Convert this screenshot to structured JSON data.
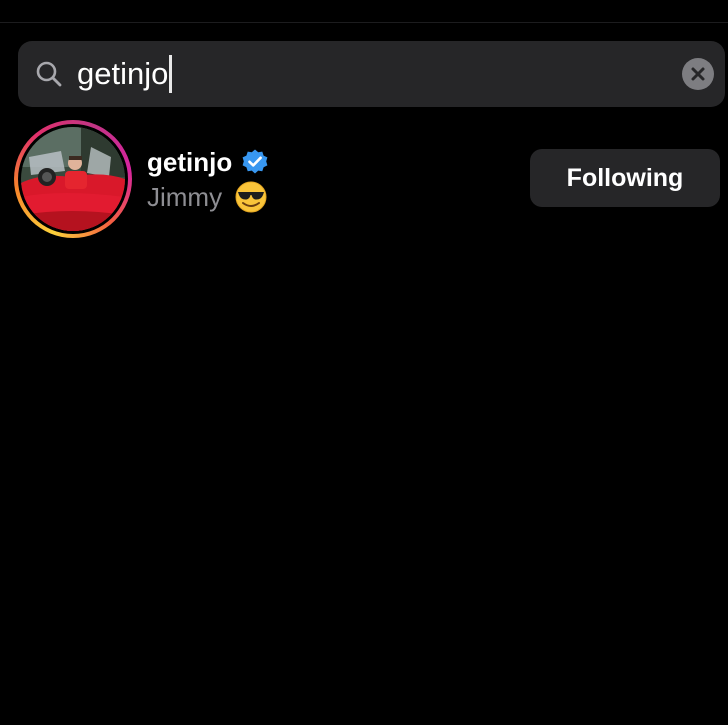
{
  "search": {
    "query": "getinjo",
    "clear_icon": "close-icon",
    "search_icon": "search-icon"
  },
  "result": {
    "username": "getinjo",
    "verified_icon": "verified-badge-icon",
    "full_name": "Jimmy",
    "full_name_emoji": "smiling-face-with-sunglasses",
    "follow_button_label": "Following",
    "story_ring": true
  },
  "colors": {
    "background": "#000000",
    "field": "#262628",
    "secondary_text": "#8e8e93",
    "verified": "#3897f0"
  }
}
